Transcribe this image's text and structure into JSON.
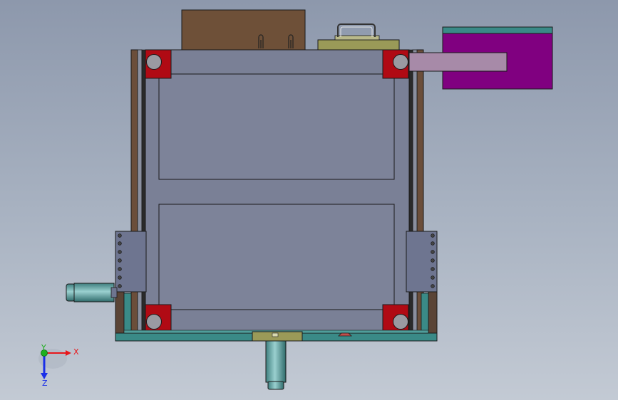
{
  "viewport": {
    "background_top": "#8d98ac",
    "background_bottom": "#c3cad4"
  },
  "colors": {
    "frame": "#7a8096",
    "panel": "#7b8198",
    "bracket_red": "#b10a14",
    "wood": "#6b4e3a",
    "motor_purple": "#800080",
    "motor_cap": "#3f8a87",
    "arm": "#a68aa8",
    "teal_base": "#3a8a87",
    "olive": "#9a9a5a",
    "cylinder": "#5f9a9a"
  },
  "triad": {
    "x_label": "X",
    "y_label": "Y",
    "z_label": "Z",
    "x_color": "#e8161a",
    "y_color": "#1fb01f",
    "z_color": "#1a2fe8"
  }
}
